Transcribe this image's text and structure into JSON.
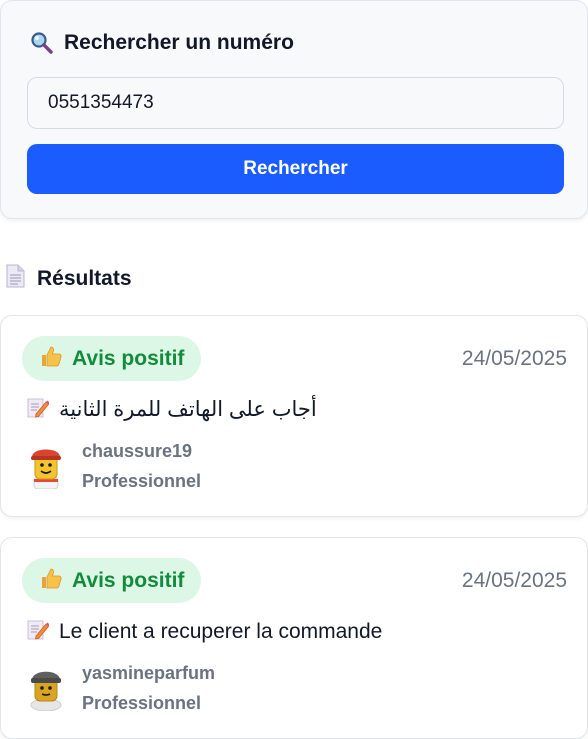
{
  "search": {
    "title": "Rechercher un numéro",
    "input_value": "0551354473",
    "button_label": "Rechercher",
    "title_icon": "magnifier-icon"
  },
  "results": {
    "heading": "Résultats",
    "heading_icon": "document-icon",
    "items": [
      {
        "badge_label": "Avis positif",
        "badge_icon": "thumbs-up-icon",
        "date": "24/05/2025",
        "comment": "أجاب على الهاتف للمرة الثانية",
        "comment_icon": "memo-icon",
        "username": "chaussure19",
        "usertype": "Professionnel",
        "avatar_icon": "worker-avatar-icon"
      },
      {
        "badge_label": "Avis positif",
        "badge_icon": "thumbs-up-icon",
        "date": "24/05/2025",
        "comment": "Le client a recuperer la commande",
        "comment_icon": "memo-icon",
        "username": "yasmineparfum",
        "usertype": "Professionnel",
        "avatar_icon": "beanie-avatar-icon"
      }
    ]
  },
  "colors": {
    "primary": "#1a5cff",
    "positive_bg": "#dcf7e6",
    "positive_text": "#148a3c",
    "muted": "#6b7280"
  }
}
